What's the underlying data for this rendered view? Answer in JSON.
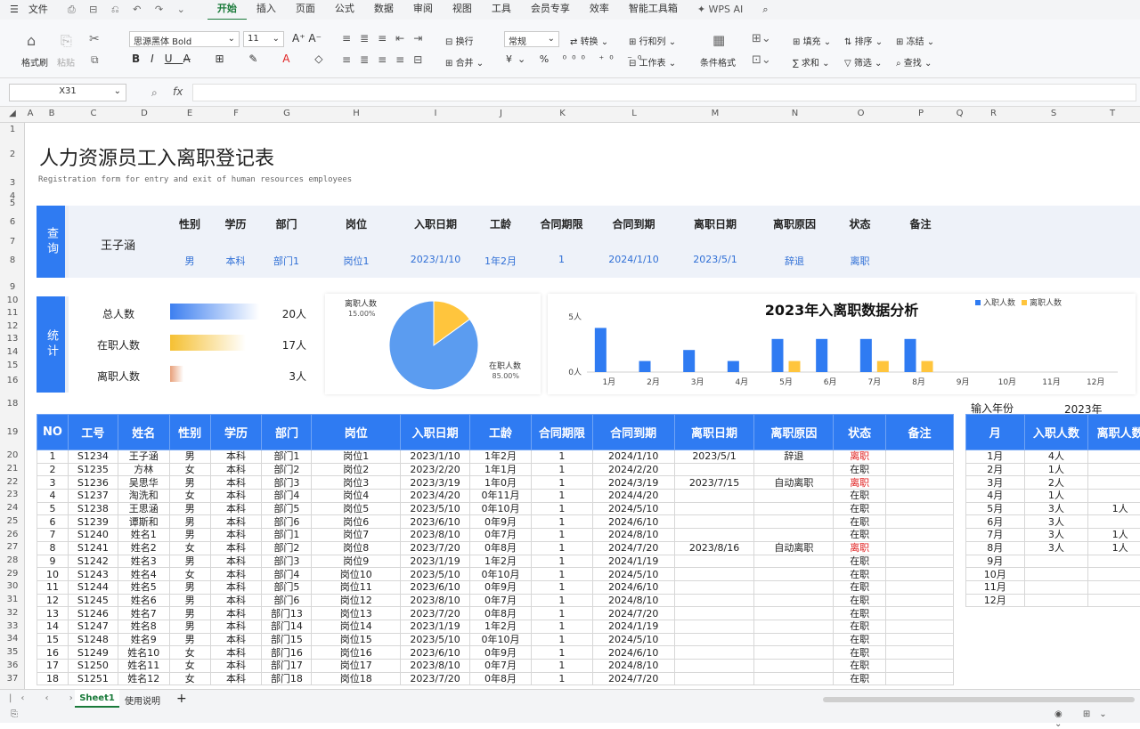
{
  "menubar": {
    "file": "文件",
    "tabs": [
      "开始",
      "插入",
      "页面",
      "公式",
      "数据",
      "审阅",
      "视图",
      "工具",
      "会员专享",
      "效率",
      "智能工具箱"
    ],
    "active_tab": "开始",
    "wps_ai": "WPS AI"
  },
  "ribbon": {
    "format_painter": "格式刷",
    "paste": "粘贴",
    "font_name": "思源黑体 Bold",
    "font_size": "11",
    "wrap": "换行",
    "merge": "合并",
    "number_format": "常规",
    "convert": "转换",
    "rows_cols": "行和列",
    "worksheet": "工作表",
    "cond_format": "条件格式",
    "fill": "填充",
    "sort": "排序",
    "freeze": "冻结",
    "sum": "求和",
    "filter": "筛选",
    "find": "查找"
  },
  "formula_bar": {
    "cell_ref": "X31",
    "fx": "fx",
    "value": ""
  },
  "columns": [
    "A",
    "B",
    "C",
    "D",
    "E",
    "F",
    "G",
    "H",
    "I",
    "J",
    "K",
    "L",
    "M",
    "N",
    "O",
    "P",
    "Q",
    "R",
    "S",
    "T"
  ],
  "rows": [
    "1",
    "2",
    "3",
    "4",
    "5",
    "6",
    "7",
    "8",
    "9",
    "10",
    "11",
    "12",
    "13",
    "14",
    "15",
    "16",
    "18",
    "19",
    "20",
    "21",
    "22",
    "23",
    "24",
    "25",
    "26",
    "27",
    "28",
    "29",
    "30",
    "31",
    "32",
    "33",
    "34",
    "35",
    "36",
    "37"
  ],
  "sheet": {
    "title": "人力资源员工入离职登记表",
    "subtitle": "Registration form for entry and exit of human resources employees",
    "query": {
      "label": "查询",
      "name": "王子涵",
      "headers": [
        "性别",
        "学历",
        "部门",
        "岗位",
        "入职日期",
        "工龄",
        "合同期限",
        "合同到期",
        "离职日期",
        "离职原因",
        "状态",
        "备注"
      ],
      "values": [
        "男",
        "本科",
        "部门1",
        "岗位1",
        "2023/1/10",
        "1年2月",
        "1",
        "2024/1/10",
        "2023/5/1",
        "辞退",
        "离职",
        ""
      ]
    },
    "stats": {
      "label": "统计",
      "rows": [
        {
          "label": "总人数",
          "value": "20人",
          "ratio": 1.0,
          "color": "#3d7ff0"
        },
        {
          "label": "在职人数",
          "value": "17人",
          "ratio": 0.85,
          "color": "#f5c032"
        },
        {
          "label": "离职人数",
          "value": "3人",
          "ratio": 0.15,
          "color": "#e8a07a"
        }
      ]
    },
    "pie": {
      "slices": [
        {
          "label": "离职人数",
          "pct": "15.00%",
          "value": 15,
          "color": "#ffc53d"
        },
        {
          "label": "在职人数",
          "pct": "85.00%",
          "value": 85,
          "color": "#5b9cf0"
        }
      ]
    },
    "main_table": {
      "headers": [
        "NO",
        "工号",
        "姓名",
        "性别",
        "学历",
        "部门",
        "岗位",
        "入职日期",
        "工龄",
        "合同期限",
        "合同到期",
        "离职日期",
        "离职原因",
        "状态",
        "备注"
      ],
      "rows": [
        [
          "1",
          "S1234",
          "王子涵",
          "男",
          "本科",
          "部门1",
          "岗位1",
          "2023/1/10",
          "1年2月",
          "1",
          "2024/1/10",
          "2023/5/1",
          "辞退",
          "离职",
          ""
        ],
        [
          "2",
          "S1235",
          "方林",
          "女",
          "本科",
          "部门2",
          "岗位2",
          "2023/2/20",
          "1年1月",
          "1",
          "2024/2/20",
          "",
          "",
          "在职",
          ""
        ],
        [
          "3",
          "S1236",
          "吴思华",
          "男",
          "本科",
          "部门3",
          "岗位3",
          "2023/3/19",
          "1年0月",
          "1",
          "2024/3/19",
          "2023/7/15",
          "自动离职",
          "离职",
          ""
        ],
        [
          "4",
          "S1237",
          "淘洗和",
          "女",
          "本科",
          "部门4",
          "岗位4",
          "2023/4/20",
          "0年11月",
          "1",
          "2024/4/20",
          "",
          "",
          "在职",
          ""
        ],
        [
          "5",
          "S1238",
          "王思涵",
          "男",
          "本科",
          "部门5",
          "岗位5",
          "2023/5/10",
          "0年10月",
          "1",
          "2024/5/10",
          "",
          "",
          "在职",
          ""
        ],
        [
          "6",
          "S1239",
          "谭斯和",
          "男",
          "本科",
          "部门6",
          "岗位6",
          "2023/6/10",
          "0年9月",
          "1",
          "2024/6/10",
          "",
          "",
          "在职",
          ""
        ],
        [
          "7",
          "S1240",
          "姓名1",
          "男",
          "本科",
          "部门1",
          "岗位7",
          "2023/8/10",
          "0年7月",
          "1",
          "2024/8/10",
          "",
          "",
          "在职",
          ""
        ],
        [
          "8",
          "S1241",
          "姓名2",
          "女",
          "本科",
          "部门2",
          "岗位8",
          "2023/7/20",
          "0年8月",
          "1",
          "2024/7/20",
          "2023/8/16",
          "自动离职",
          "离职",
          ""
        ],
        [
          "9",
          "S1242",
          "姓名3",
          "男",
          "本科",
          "部门3",
          "岗位9",
          "2023/1/19",
          "1年2月",
          "1",
          "2024/1/19",
          "",
          "",
          "在职",
          ""
        ],
        [
          "10",
          "S1243",
          "姓名4",
          "女",
          "本科",
          "部门4",
          "岗位10",
          "2023/5/10",
          "0年10月",
          "1",
          "2024/5/10",
          "",
          "",
          "在职",
          ""
        ],
        [
          "11",
          "S1244",
          "姓名5",
          "男",
          "本科",
          "部门5",
          "岗位11",
          "2023/6/10",
          "0年9月",
          "1",
          "2024/6/10",
          "",
          "",
          "在职",
          ""
        ],
        [
          "12",
          "S1245",
          "姓名6",
          "男",
          "本科",
          "部门6",
          "岗位12",
          "2023/8/10",
          "0年7月",
          "1",
          "2024/8/10",
          "",
          "",
          "在职",
          ""
        ],
        [
          "13",
          "S1246",
          "姓名7",
          "男",
          "本科",
          "部门13",
          "岗位13",
          "2023/7/20",
          "0年8月",
          "1",
          "2024/7/20",
          "",
          "",
          "在职",
          ""
        ],
        [
          "14",
          "S1247",
          "姓名8",
          "男",
          "本科",
          "部门14",
          "岗位14",
          "2023/1/19",
          "1年2月",
          "1",
          "2024/1/19",
          "",
          "",
          "在职",
          ""
        ],
        [
          "15",
          "S1248",
          "姓名9",
          "男",
          "本科",
          "部门15",
          "岗位15",
          "2023/5/10",
          "0年10月",
          "1",
          "2024/5/10",
          "",
          "",
          "在职",
          ""
        ],
        [
          "16",
          "S1249",
          "姓名10",
          "女",
          "本科",
          "部门16",
          "岗位16",
          "2023/6/10",
          "0年9月",
          "1",
          "2024/6/10",
          "",
          "",
          "在职",
          ""
        ],
        [
          "17",
          "S1250",
          "姓名11",
          "女",
          "本科",
          "部门17",
          "岗位17",
          "2023/8/10",
          "0年7月",
          "1",
          "2024/8/10",
          "",
          "",
          "在职",
          ""
        ],
        [
          "18",
          "S1251",
          "姓名12",
          "女",
          "本科",
          "部门18",
          "岗位18",
          "2023/7/20",
          "0年8月",
          "1",
          "2024/7/20",
          "",
          "",
          "在职",
          ""
        ]
      ]
    },
    "month_table": {
      "year_label": "输入年份",
      "year": "2023年",
      "headers": [
        "月",
        "入职人数",
        "离职人数"
      ],
      "rows": [
        [
          "1月",
          "4人",
          ""
        ],
        [
          "2月",
          "1人",
          ""
        ],
        [
          "3月",
          "2人",
          ""
        ],
        [
          "4月",
          "1人",
          ""
        ],
        [
          "5月",
          "3人",
          "1人"
        ],
        [
          "6月",
          "3人",
          ""
        ],
        [
          "7月",
          "3人",
          "1人"
        ],
        [
          "8月",
          "3人",
          "1人"
        ],
        [
          "9月",
          "",
          ""
        ],
        [
          "10月",
          "",
          ""
        ],
        [
          "11月",
          "",
          ""
        ],
        [
          "12月",
          "",
          ""
        ]
      ]
    }
  },
  "chart_data": {
    "type": "bar",
    "title": "2023年入离职数据分析",
    "categories": [
      "1月",
      "2月",
      "3月",
      "4月",
      "5月",
      "6月",
      "7月",
      "8月",
      "9月",
      "10月",
      "11月",
      "12月"
    ],
    "series": [
      {
        "name": "入职人数",
        "color": "#2f7bf2",
        "values": [
          4,
          1,
          2,
          1,
          3,
          3,
          3,
          3,
          0,
          0,
          0,
          0
        ]
      },
      {
        "name": "离职人数",
        "color": "#ffc53d",
        "values": [
          0,
          0,
          0,
          0,
          1,
          0,
          1,
          1,
          0,
          0,
          0,
          0
        ]
      }
    ],
    "y_ticks": [
      "0人",
      "5人"
    ],
    "ylim": [
      0,
      5
    ],
    "legend": "top-right"
  },
  "tabs": {
    "sheets": [
      "Sheet1",
      "使用说明"
    ],
    "active": "Sheet1"
  }
}
